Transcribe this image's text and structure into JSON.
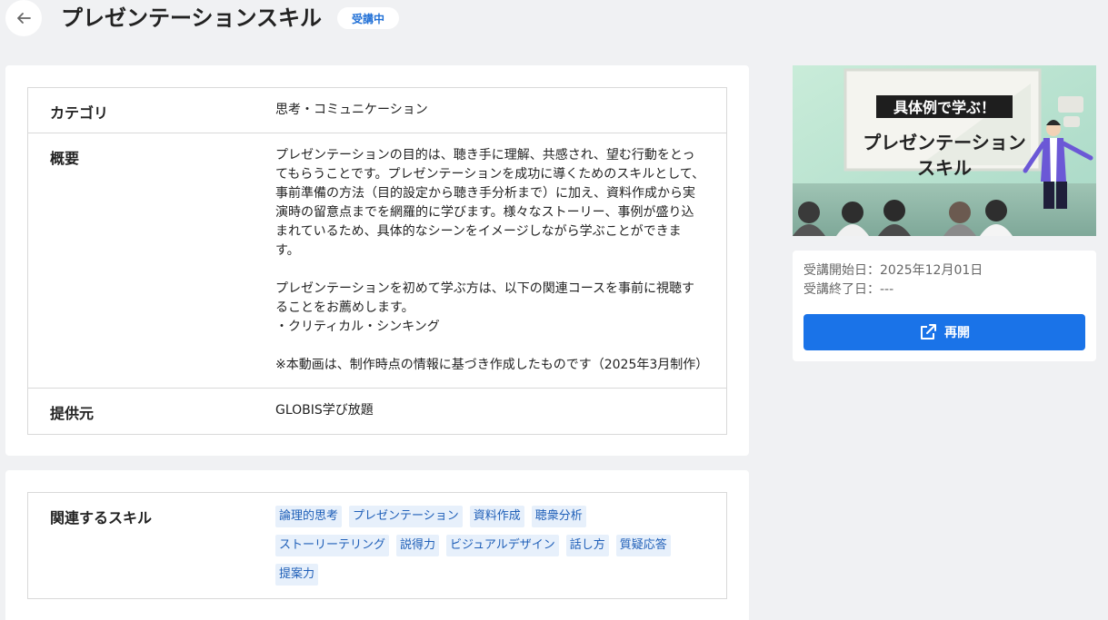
{
  "header": {
    "title": "プレゼンテーションスキル",
    "status_badge": "受講中"
  },
  "info": {
    "category_label": "カテゴリ",
    "category_value": "思考・コミュニケーション",
    "overview_label": "概要",
    "overview_lines": [
      "プレゼンテーションの目的は、聴き手に理解、共感され、望む行動をとっ",
      "てもらうことです。プレゼンテーションを成功に導くためのスキルとして、",
      "事前準備の方法（目的設定から聴き手分析まで）に加え、資料作成から実",
      "演時の留意点までを網羅的に学びます。様々なストーリー、事例が盛り込",
      "まれているため、具体的なシーンをイメージしながら学ぶことができま",
      "す。",
      "",
      "プレゼンテーションを初めて学ぶ方は、以下の関連コースを事前に視聴す",
      "ることをお薦めします。",
      "・クリティカル・シンキング",
      "",
      "※本動画は、制作時点の情報に基づき作成したものです（2025年3月制作）"
    ],
    "provider_label": "提供元",
    "provider_value": "GLOBIS学び放題"
  },
  "skills": {
    "label": "関連するスキル",
    "tags": [
      "論理的思考",
      "プレゼンテーション",
      "資料作成",
      "聴衆分析",
      "ストーリーテリング",
      "説得力",
      "ビジュアルデザイン",
      "話し方",
      "質疑応答",
      "提案力"
    ]
  },
  "thumbnail": {
    "banner_text": "具体例で学ぶ！",
    "title_line1": "プレゼンテーション",
    "title_line2": "スキル"
  },
  "side": {
    "start_date": "受講開始日：2025年12月01日",
    "end_date": "受講終了日：---",
    "resume_label": "再開"
  },
  "colors": {
    "accent": "#1a73e8",
    "tag_bg": "#e7f0fb",
    "tag_text": "#1f5fb8"
  }
}
